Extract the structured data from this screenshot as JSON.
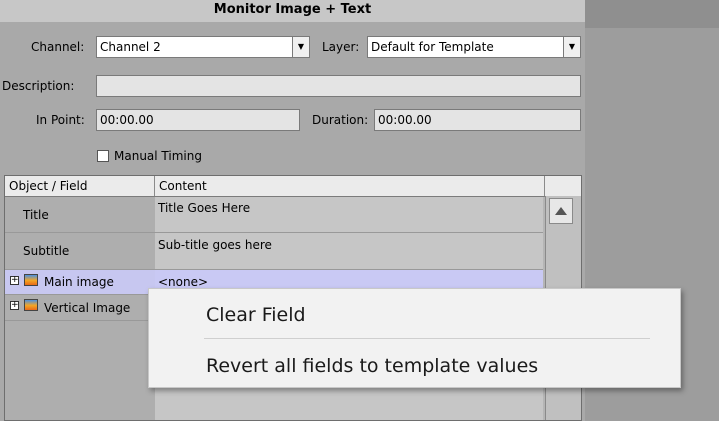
{
  "panel": {
    "title": "Monitor Image + Text"
  },
  "form": {
    "channel_label": "Channel:",
    "channel_value": "Channel 2",
    "layer_label": "Layer:",
    "layer_value": "Default for Template",
    "description_label": "Description:",
    "description_value": "",
    "in_point_label": "In Point:",
    "in_point_value": "00:00.00",
    "duration_label": "Duration:",
    "duration_value": "00:00.00",
    "manual_timing_label": "Manual Timing",
    "manual_timing_checked": false
  },
  "table": {
    "columns": [
      "Object / Field",
      "Content"
    ],
    "rows": [
      {
        "field": "Title",
        "content": "Title Goes Here"
      },
      {
        "field": "Subtitle",
        "content": "Sub-title goes here"
      },
      {
        "field": "Main image",
        "content": "<none>",
        "selected": true
      },
      {
        "field": "Vertical Image",
        "content": ""
      }
    ]
  },
  "context_menu": {
    "items": [
      "Clear Field",
      "Revert all fields to template values"
    ]
  },
  "colors": {
    "selection": "#c9c9f4",
    "panel_bg": "#a9a9a9"
  }
}
